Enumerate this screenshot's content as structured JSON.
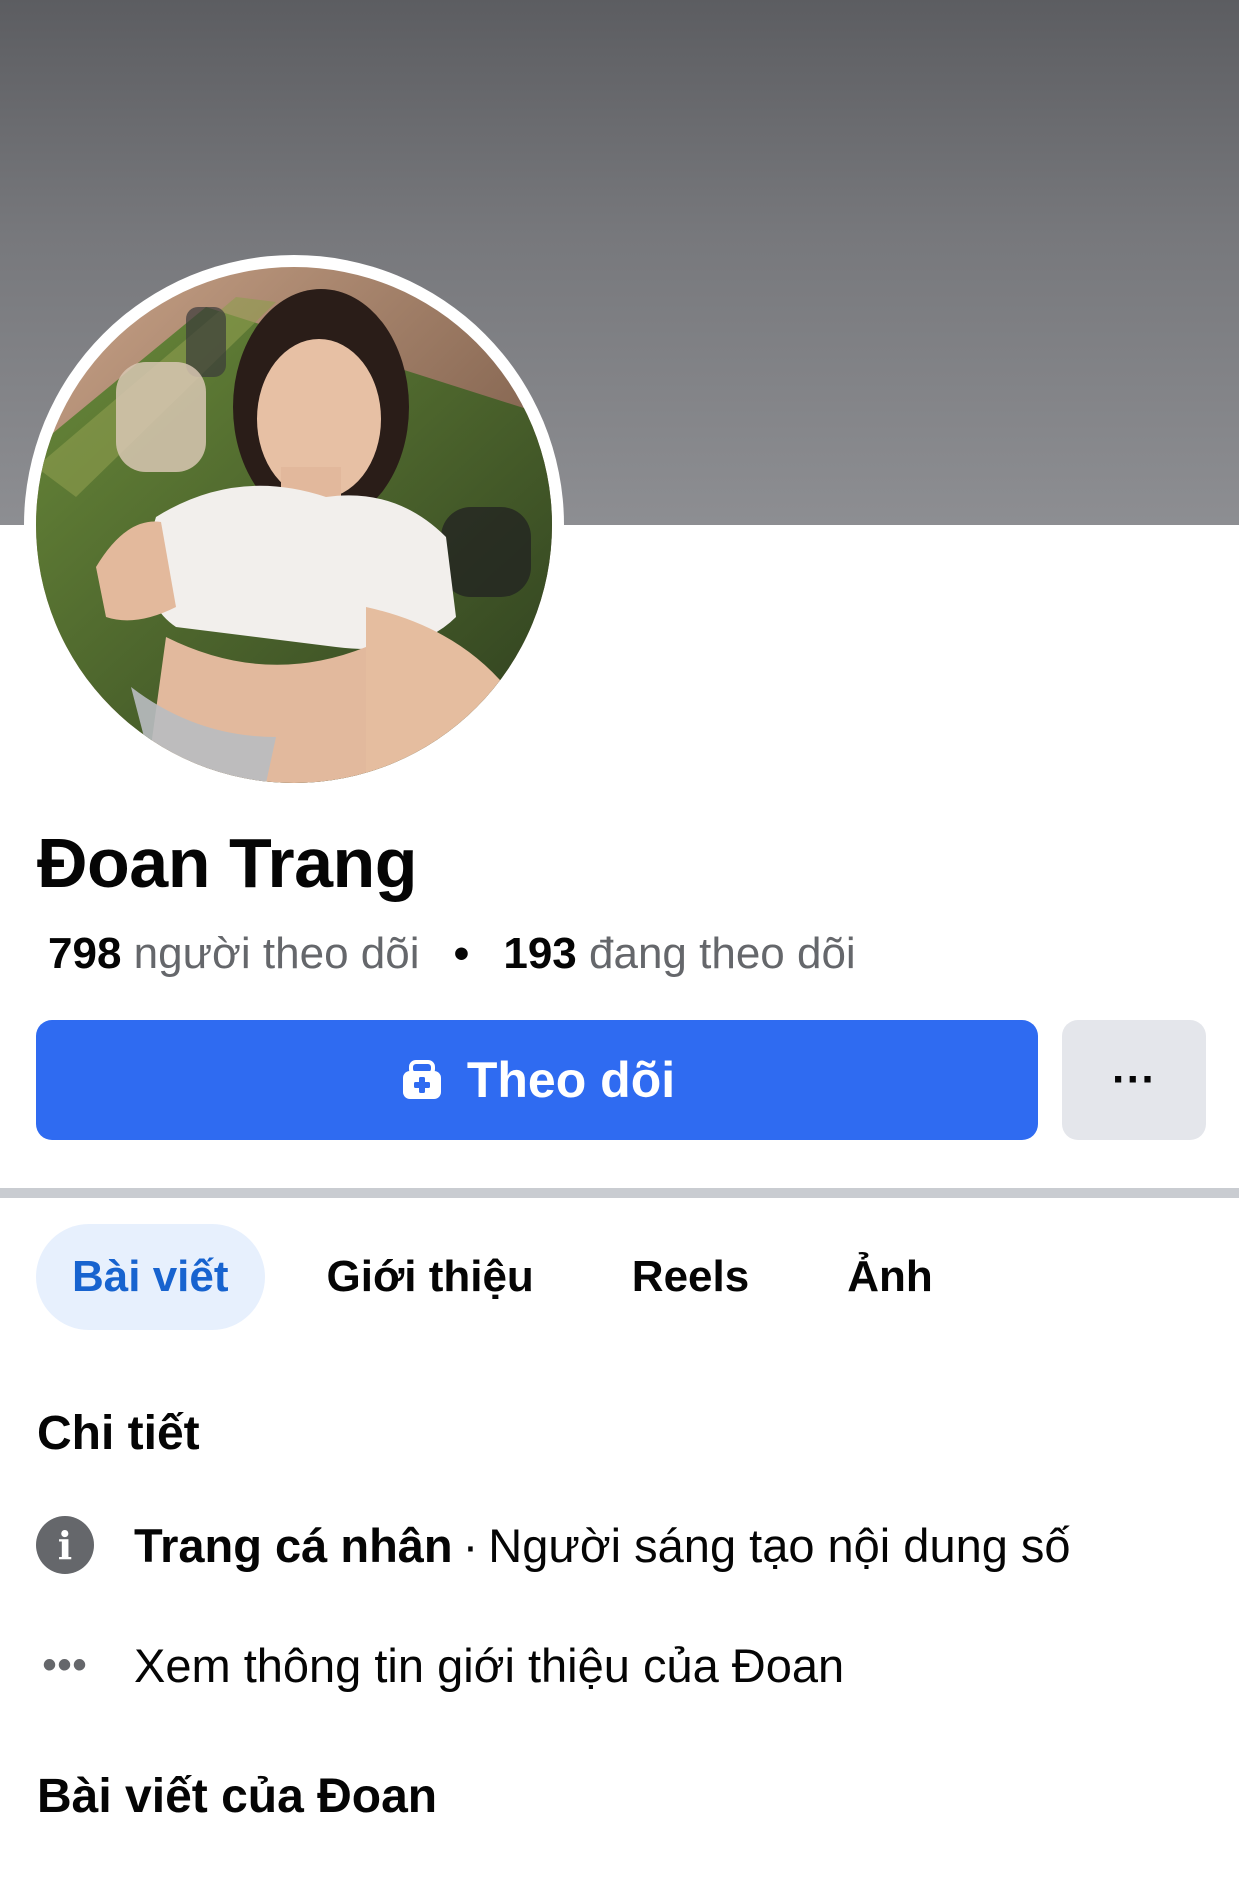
{
  "profile": {
    "name": "Đoan Trang",
    "followers_count": "798",
    "followers_label": "người theo dõi",
    "separator": "•",
    "following_count": "193",
    "following_label": "đang theo dõi"
  },
  "actions": {
    "follow_label": "Theo dõi",
    "more_label": "···"
  },
  "tabs": [
    {
      "label": "Bài viết",
      "active": true
    },
    {
      "label": "Giới thiệu",
      "active": false
    },
    {
      "label": "Reels",
      "active": false
    },
    {
      "label": "Ảnh",
      "active": false
    }
  ],
  "details": {
    "title": "Chi tiết",
    "category_label": "Trang cá nhân",
    "category_sep": "·",
    "category_value": "Người sáng tạo nội dung số",
    "more_info": "Xem thông tin giới thiệu của Đoan"
  },
  "posts": {
    "title": "Bài viết của Đoan"
  },
  "colors": {
    "primary_button": "#2f6bf1",
    "active_tab_bg": "#e7f0fd",
    "active_tab_text": "#1763cf",
    "secondary_text": "#65676b"
  },
  "icons": {
    "follow": "person-plus-icon",
    "info": "info-icon",
    "more": "more-dots-icon"
  }
}
